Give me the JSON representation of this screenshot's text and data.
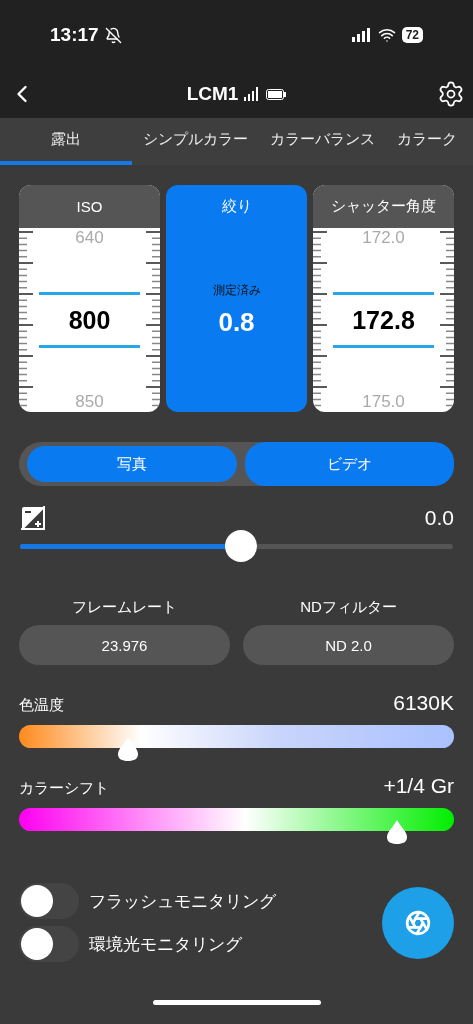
{
  "status_bar": {
    "time": "13:17",
    "battery": "72"
  },
  "nav": {
    "title": "LCM1"
  },
  "tabs": [
    {
      "label": "露出",
      "selected": true
    },
    {
      "label": "シンプルカラー",
      "selected": false
    },
    {
      "label": "カラーバランス",
      "selected": false
    },
    {
      "label": "カラーク",
      "selected": false
    }
  ],
  "dials": [
    {
      "kind": "ruler",
      "label": "ISO",
      "above": "640",
      "value": "800",
      "below": "850"
    },
    {
      "kind": "metered",
      "label": "絞り",
      "caption": "測定済み",
      "value": "0.8"
    },
    {
      "kind": "ruler",
      "label": "シャッター角度",
      "above": "172.0",
      "value": "172.8",
      "below": "175.0"
    }
  ],
  "mode": [
    {
      "label": "写真",
      "selected": false
    },
    {
      "label": "ビデオ",
      "selected": true
    }
  ],
  "exposure_compensation": {
    "reading": "0.0",
    "level": 0.51
  },
  "settings": [
    {
      "label": "フレームレート",
      "value": "23.976"
    },
    {
      "label": "NDフィルター",
      "value": "ND 2.0"
    }
  ],
  "color_sliders": [
    {
      "kind": "temperature",
      "label": "色温度",
      "reading": "6130K",
      "level": 0.25
    },
    {
      "kind": "shift",
      "label": "カラーシフト",
      "reading": "+1/4 Gr",
      "level": 0.87
    }
  ],
  "toggles": [
    {
      "label": "フラッシュモニタリング",
      "on": false
    },
    {
      "label": "環境光モニタリング",
      "on": false
    }
  ]
}
